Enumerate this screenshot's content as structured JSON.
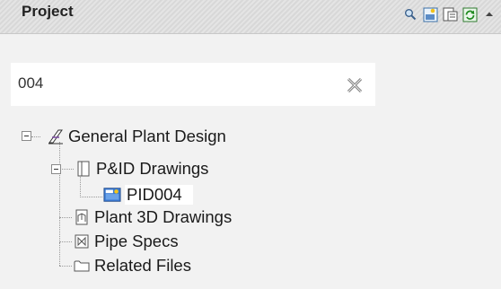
{
  "panel": {
    "title": "Project",
    "tools": [
      {
        "name": "search-icon"
      },
      {
        "name": "new-drawing-icon"
      },
      {
        "name": "project-manager-icon"
      },
      {
        "name": "refresh-icon"
      },
      {
        "name": "collapse-arrow-icon"
      }
    ]
  },
  "search": {
    "value": "004",
    "clear_icon": "close-x-icon"
  },
  "tree": {
    "root": {
      "label": "General Plant Design",
      "icon": "project-icon",
      "expanded": true
    },
    "pid_folder": {
      "label": "P&ID Drawings",
      "icon": "folder-page-icon",
      "expanded": true
    },
    "pid_file": {
      "label": "PID004",
      "icon": "drawing-file-icon",
      "selected": true
    },
    "plant3d": {
      "label": "Plant 3D Drawings",
      "icon": "plant3d-icon"
    },
    "pipe_specs": {
      "label": "Pipe Specs",
      "icon": "pipe-spec-icon"
    },
    "related": {
      "label": "Related Files",
      "icon": "folder-icon"
    }
  }
}
